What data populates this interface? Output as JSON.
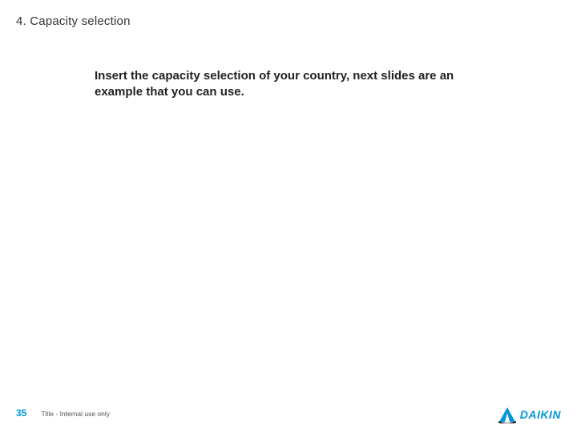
{
  "header": {
    "section_number": "4",
    "section_title": "Capacity selection",
    "full": "4. Capacity selection"
  },
  "body": {
    "instruction": "Insert the capacity selection of your country, next slides are an example that you can use."
  },
  "footer": {
    "page_number": "35",
    "note": "Title - Internal use only"
  },
  "brand": {
    "name": "DAIKIN",
    "accent_color": "#0097d6"
  }
}
